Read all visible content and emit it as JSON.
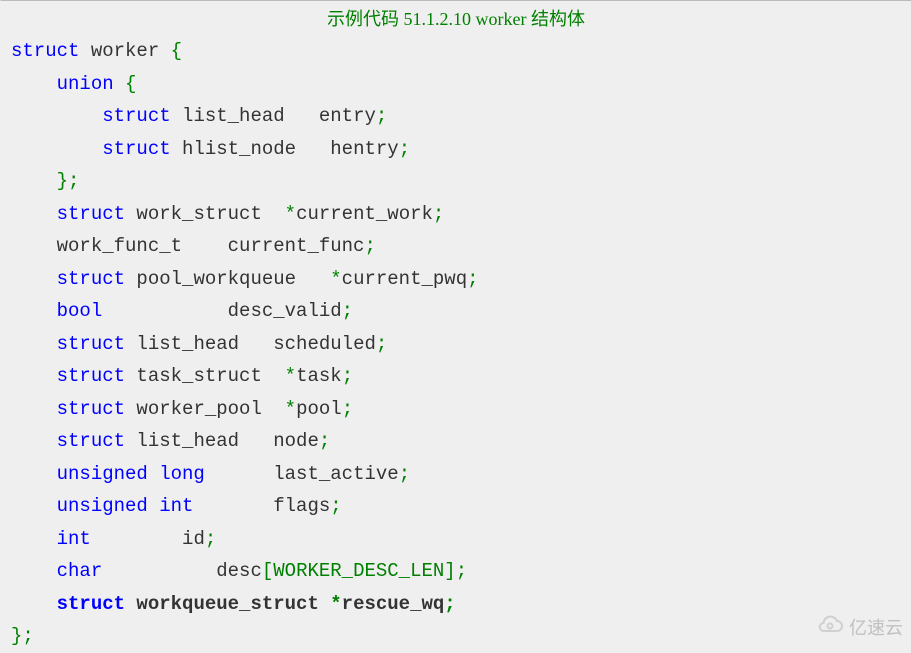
{
  "title": "示例代码 51.1.2.10 worker 结构体",
  "code": {
    "kw_struct": "struct",
    "kw_union": "union",
    "kw_bool": "bool",
    "kw_unsigned_long": "unsigned long",
    "kw_unsigned_int": "unsigned int",
    "kw_int": "int",
    "kw_char": "char",
    "name_worker": " worker ",
    "name_list_head_entry": " list_head   entry",
    "name_hlist_node_hentry": " hlist_node   hentry",
    "name_work_struct_current_work": " work_struct  ",
    "star_current_work": "*",
    "id_current_work": "current_work",
    "name_work_func_t": "    work_func_t    current_func",
    "name_pool_workqueue": " pool_workqueue   ",
    "star_current_pwq": "*",
    "id_current_pwq": "current_pwq",
    "name_desc_valid": "           desc_valid",
    "name_list_head_scheduled": " list_head   scheduled",
    "name_task_struct": " task_struct  ",
    "star_task": "*",
    "id_task": "task",
    "name_worker_pool": " worker_pool  ",
    "star_pool": "*",
    "id_pool": "pool",
    "name_list_head_node": " list_head   node",
    "name_last_active": "      last_active",
    "name_flags": "       flags",
    "name_id": "        id",
    "name_desc": "          desc",
    "const_worker_desc_len": "WORKER_DESC_LEN",
    "name_workqueue_struct": " workqueue_struct ",
    "star_rescue_wq": "*",
    "id_rescue_wq": "rescue_wq",
    "brace_open": "{",
    "brace_close": "}",
    "brace_close_semi": "};",
    "bracket_open": "[",
    "bracket_close_semi": "];",
    "semi": ";"
  },
  "watermark": {
    "text": "亿速云"
  }
}
